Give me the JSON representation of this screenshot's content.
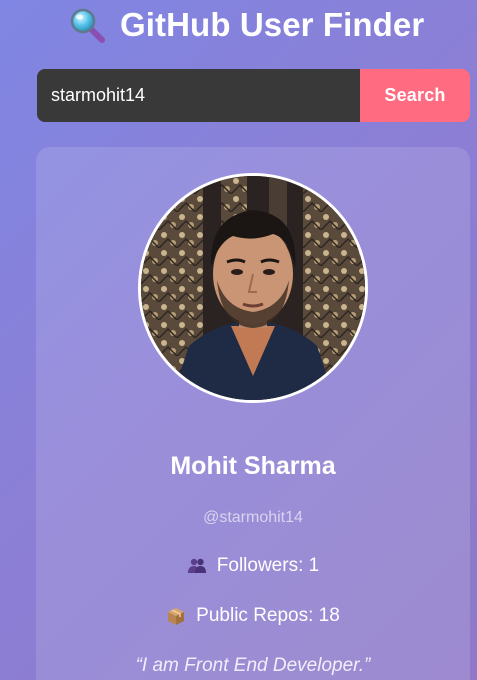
{
  "header": {
    "title": "GitHub User Finder",
    "icon": "magnifying-glass-icon"
  },
  "search": {
    "value": "starmohit14",
    "placeholder": "",
    "button_label": "Search",
    "button_color": "#ff6b81"
  },
  "profile": {
    "avatar_alt": "avatar",
    "name": "Mohit Sharma",
    "username": "@starmohit14",
    "followers_icon": "people-icon",
    "followers_text": "Followers: 1",
    "repos_icon": "package-icon",
    "repos_text": "Public Repos: 18",
    "bio": "“I am Front End Developer.”"
  },
  "colors": {
    "background_start": "#7f86e3",
    "background_end": "#8f79c8",
    "input_background": "#393939",
    "accent": "#ff6b81"
  }
}
